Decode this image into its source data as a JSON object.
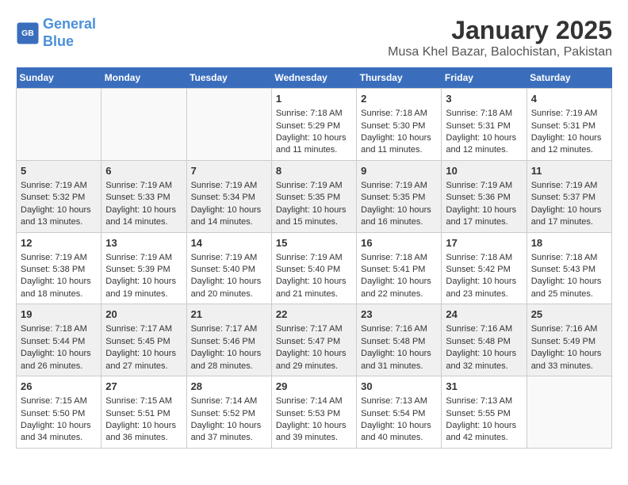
{
  "logo": {
    "line1": "General",
    "line2": "Blue"
  },
  "title": "January 2025",
  "subtitle": "Musa Khel Bazar, Balochistan, Pakistan",
  "weekdays": [
    "Sunday",
    "Monday",
    "Tuesday",
    "Wednesday",
    "Thursday",
    "Friday",
    "Saturday"
  ],
  "weeks": [
    [
      {
        "day": "",
        "sunrise": "",
        "sunset": "",
        "daylight": ""
      },
      {
        "day": "",
        "sunrise": "",
        "sunset": "",
        "daylight": ""
      },
      {
        "day": "",
        "sunrise": "",
        "sunset": "",
        "daylight": ""
      },
      {
        "day": "1",
        "sunrise": "Sunrise: 7:18 AM",
        "sunset": "Sunset: 5:29 PM",
        "daylight": "Daylight: 10 hours and 11 minutes."
      },
      {
        "day": "2",
        "sunrise": "Sunrise: 7:18 AM",
        "sunset": "Sunset: 5:30 PM",
        "daylight": "Daylight: 10 hours and 11 minutes."
      },
      {
        "day": "3",
        "sunrise": "Sunrise: 7:18 AM",
        "sunset": "Sunset: 5:31 PM",
        "daylight": "Daylight: 10 hours and 12 minutes."
      },
      {
        "day": "4",
        "sunrise": "Sunrise: 7:19 AM",
        "sunset": "Sunset: 5:31 PM",
        "daylight": "Daylight: 10 hours and 12 minutes."
      }
    ],
    [
      {
        "day": "5",
        "sunrise": "Sunrise: 7:19 AM",
        "sunset": "Sunset: 5:32 PM",
        "daylight": "Daylight: 10 hours and 13 minutes."
      },
      {
        "day": "6",
        "sunrise": "Sunrise: 7:19 AM",
        "sunset": "Sunset: 5:33 PM",
        "daylight": "Daylight: 10 hours and 14 minutes."
      },
      {
        "day": "7",
        "sunrise": "Sunrise: 7:19 AM",
        "sunset": "Sunset: 5:34 PM",
        "daylight": "Daylight: 10 hours and 14 minutes."
      },
      {
        "day": "8",
        "sunrise": "Sunrise: 7:19 AM",
        "sunset": "Sunset: 5:35 PM",
        "daylight": "Daylight: 10 hours and 15 minutes."
      },
      {
        "day": "9",
        "sunrise": "Sunrise: 7:19 AM",
        "sunset": "Sunset: 5:35 PM",
        "daylight": "Daylight: 10 hours and 16 minutes."
      },
      {
        "day": "10",
        "sunrise": "Sunrise: 7:19 AM",
        "sunset": "Sunset: 5:36 PM",
        "daylight": "Daylight: 10 hours and 17 minutes."
      },
      {
        "day": "11",
        "sunrise": "Sunrise: 7:19 AM",
        "sunset": "Sunset: 5:37 PM",
        "daylight": "Daylight: 10 hours and 17 minutes."
      }
    ],
    [
      {
        "day": "12",
        "sunrise": "Sunrise: 7:19 AM",
        "sunset": "Sunset: 5:38 PM",
        "daylight": "Daylight: 10 hours and 18 minutes."
      },
      {
        "day": "13",
        "sunrise": "Sunrise: 7:19 AM",
        "sunset": "Sunset: 5:39 PM",
        "daylight": "Daylight: 10 hours and 19 minutes."
      },
      {
        "day": "14",
        "sunrise": "Sunrise: 7:19 AM",
        "sunset": "Sunset: 5:40 PM",
        "daylight": "Daylight: 10 hours and 20 minutes."
      },
      {
        "day": "15",
        "sunrise": "Sunrise: 7:19 AM",
        "sunset": "Sunset: 5:40 PM",
        "daylight": "Daylight: 10 hours and 21 minutes."
      },
      {
        "day": "16",
        "sunrise": "Sunrise: 7:18 AM",
        "sunset": "Sunset: 5:41 PM",
        "daylight": "Daylight: 10 hours and 22 minutes."
      },
      {
        "day": "17",
        "sunrise": "Sunrise: 7:18 AM",
        "sunset": "Sunset: 5:42 PM",
        "daylight": "Daylight: 10 hours and 23 minutes."
      },
      {
        "day": "18",
        "sunrise": "Sunrise: 7:18 AM",
        "sunset": "Sunset: 5:43 PM",
        "daylight": "Daylight: 10 hours and 25 minutes."
      }
    ],
    [
      {
        "day": "19",
        "sunrise": "Sunrise: 7:18 AM",
        "sunset": "Sunset: 5:44 PM",
        "daylight": "Daylight: 10 hours and 26 minutes."
      },
      {
        "day": "20",
        "sunrise": "Sunrise: 7:17 AM",
        "sunset": "Sunset: 5:45 PM",
        "daylight": "Daylight: 10 hours and 27 minutes."
      },
      {
        "day": "21",
        "sunrise": "Sunrise: 7:17 AM",
        "sunset": "Sunset: 5:46 PM",
        "daylight": "Daylight: 10 hours and 28 minutes."
      },
      {
        "day": "22",
        "sunrise": "Sunrise: 7:17 AM",
        "sunset": "Sunset: 5:47 PM",
        "daylight": "Daylight: 10 hours and 29 minutes."
      },
      {
        "day": "23",
        "sunrise": "Sunrise: 7:16 AM",
        "sunset": "Sunset: 5:48 PM",
        "daylight": "Daylight: 10 hours and 31 minutes."
      },
      {
        "day": "24",
        "sunrise": "Sunrise: 7:16 AM",
        "sunset": "Sunset: 5:48 PM",
        "daylight": "Daylight: 10 hours and 32 minutes."
      },
      {
        "day": "25",
        "sunrise": "Sunrise: 7:16 AM",
        "sunset": "Sunset: 5:49 PM",
        "daylight": "Daylight: 10 hours and 33 minutes."
      }
    ],
    [
      {
        "day": "26",
        "sunrise": "Sunrise: 7:15 AM",
        "sunset": "Sunset: 5:50 PM",
        "daylight": "Daylight: 10 hours and 34 minutes."
      },
      {
        "day": "27",
        "sunrise": "Sunrise: 7:15 AM",
        "sunset": "Sunset: 5:51 PM",
        "daylight": "Daylight: 10 hours and 36 minutes."
      },
      {
        "day": "28",
        "sunrise": "Sunrise: 7:14 AM",
        "sunset": "Sunset: 5:52 PM",
        "daylight": "Daylight: 10 hours and 37 minutes."
      },
      {
        "day": "29",
        "sunrise": "Sunrise: 7:14 AM",
        "sunset": "Sunset: 5:53 PM",
        "daylight": "Daylight: 10 hours and 39 minutes."
      },
      {
        "day": "30",
        "sunrise": "Sunrise: 7:13 AM",
        "sunset": "Sunset: 5:54 PM",
        "daylight": "Daylight: 10 hours and 40 minutes."
      },
      {
        "day": "31",
        "sunrise": "Sunrise: 7:13 AM",
        "sunset": "Sunset: 5:55 PM",
        "daylight": "Daylight: 10 hours and 42 minutes."
      },
      {
        "day": "",
        "sunrise": "",
        "sunset": "",
        "daylight": ""
      }
    ]
  ],
  "row_shading": [
    false,
    true,
    false,
    true,
    false
  ]
}
